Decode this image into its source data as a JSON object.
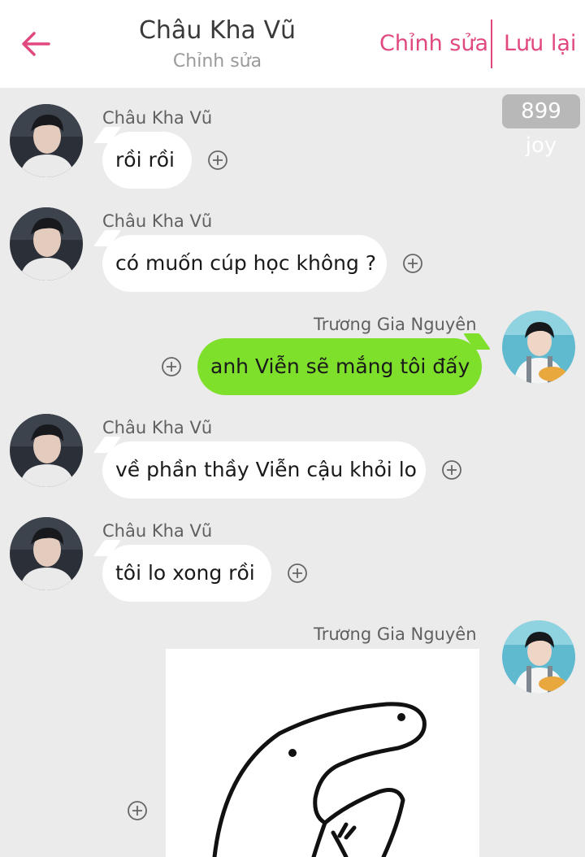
{
  "header": {
    "title": "Châu Kha Vũ",
    "subtitle": "Chỉnh sửa",
    "edit_label": "Chỉnh sửa",
    "save_label": "Lưu lại",
    "accent_color": "#e0487f"
  },
  "joy_badge": "899 joy",
  "colors": {
    "background": "#ebebeb",
    "incoming_bubble": "#ffffff",
    "outgoing_bubble": "#7fe02c"
  },
  "messages": [
    {
      "sender": "Châu Kha Vũ",
      "direction": "incoming",
      "text": "rồi rồi"
    },
    {
      "sender": "Châu Kha Vũ",
      "direction": "incoming",
      "text": "có muốn cúp học không ?"
    },
    {
      "sender": "Trương Gia Nguyên",
      "direction": "outgoing",
      "text": "anh Viễn sẽ mắng tôi đấy"
    },
    {
      "sender": "Châu Kha Vũ",
      "direction": "incoming",
      "text": "về phần thầy Viễn cậu khỏi lo"
    },
    {
      "sender": "Châu Kha Vũ",
      "direction": "incoming",
      "text": "tôi lo xong rồi"
    },
    {
      "sender": "Trương Gia Nguyên",
      "direction": "outgoing",
      "type": "sticker"
    }
  ]
}
